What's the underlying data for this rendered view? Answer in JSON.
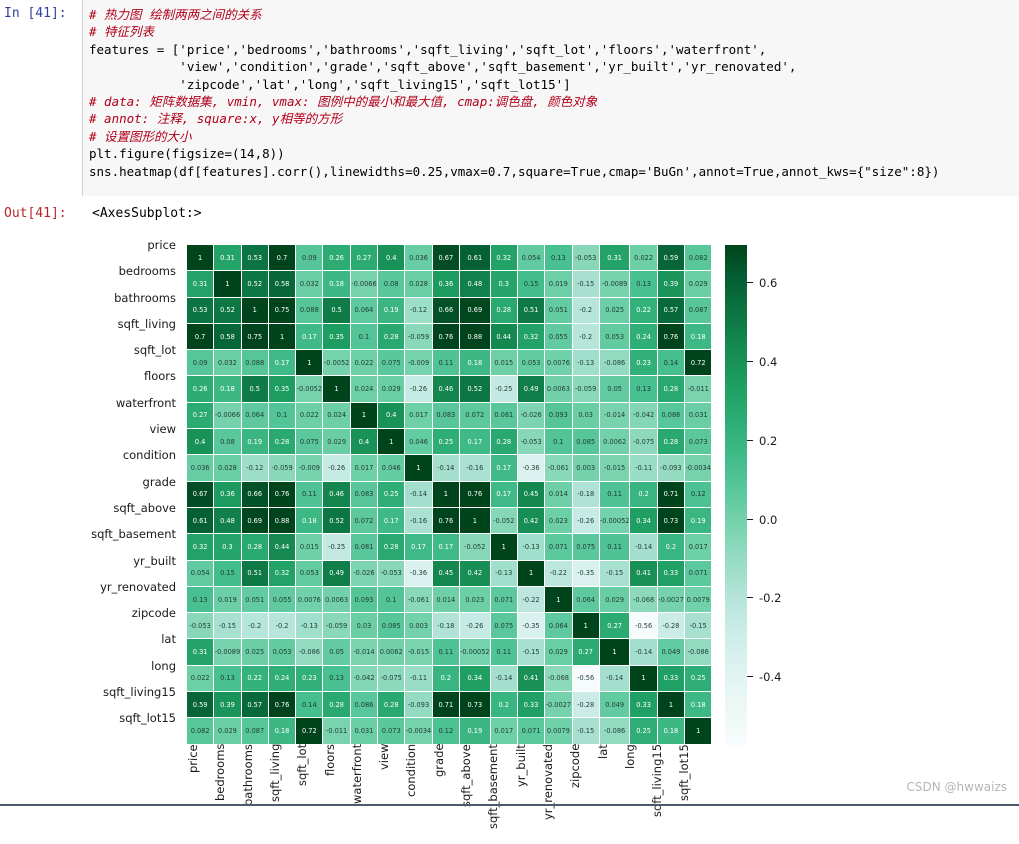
{
  "notebook": {
    "in_prompt": "In [41]:",
    "out_prompt": "Out[41]:",
    "out_text": "<AxesSubplot:>",
    "code_lines": [
      "# 热力图 绘制两两之间的关系",
      "# 特征列表",
      "features = ['price','bedrooms','bathrooms','sqft_living','sqft_lot','floors','waterfront',",
      "            'view','condition','grade','sqft_above','sqft_basement','yr_built','yr_renovated',",
      "            'zipcode','lat','long','sqft_living15','sqft_lot15']",
      "# data: 矩阵数据集, vmin, vmax: 图例中的最小和最大值, cmap:调色盘, 颜色对象",
      "# annot: 注释, square:x, y相等的方形",
      "# 设置图形的大小",
      "plt.figure(figsize=(14,8))",
      "sns.heatmap(df[features].corr(),linewidths=0.25,vmax=0.7,square=True,cmap='BuGn',annot=True,annot_kws={\"size\":8})"
    ]
  },
  "watermark": "CSDN @hwwaizs",
  "chart_data": {
    "type": "heatmap",
    "title": "",
    "xlabel": "",
    "ylabel": "",
    "cmap": "BuGn",
    "vmax": 0.7,
    "linewidths": 0.25,
    "annot": true,
    "square": true,
    "grid": false,
    "legend_position": "right",
    "colorbar_ticks": [
      "0.6",
      "0.4",
      "0.2",
      "0.0",
      "-0.2",
      "-0.4"
    ],
    "colorbar_range": [
      -0.57,
      0.7
    ],
    "categories": [
      "price",
      "bedrooms",
      "bathrooms",
      "sqft_living",
      "sqft_lot",
      "floors",
      "waterfront",
      "view",
      "condition",
      "grade",
      "sqft_above",
      "sqft_basement",
      "yr_built",
      "yr_renovated",
      "zipcode",
      "lat",
      "long",
      "sqft_living15",
      "sqft_lot15"
    ],
    "x": [
      "price",
      "bedrooms",
      "bathrooms",
      "sqft_living",
      "sqft_lot",
      "floors",
      "waterfront",
      "view",
      "condition",
      "grade",
      "sqft_above",
      "sqft_basement",
      "yr_built",
      "yr_renovated",
      "zipcode",
      "lat",
      "long",
      "sqft_living15",
      "sqft_lot15"
    ],
    "y": [
      "price",
      "bedrooms",
      "bathrooms",
      "sqft_living",
      "sqft_lot",
      "floors",
      "waterfront",
      "view",
      "condition",
      "grade",
      "sqft_above",
      "sqft_basement",
      "yr_built",
      "yr_renovated",
      "zipcode",
      "lat",
      "long",
      "sqft_living15",
      "sqft_lot15"
    ],
    "values": [
      [
        "1",
        "0.31",
        "0.53",
        "0.7",
        "0.09",
        "0.26",
        "0.27",
        "0.4",
        "0.036",
        "0.67",
        "0.61",
        "0.32",
        "0.054",
        "0.13",
        "-0.053",
        "0.31",
        "0.022",
        "0.59",
        "0.082"
      ],
      [
        "0.31",
        "1",
        "0.52",
        "0.58",
        "0.032",
        "0.18",
        "-0.0066",
        "0.08",
        "0.028",
        "0.36",
        "0.48",
        "0.3",
        "0.15",
        "0.019",
        "-0.15",
        "-0.0089",
        "0.13",
        "0.39",
        "0.029"
      ],
      [
        "0.53",
        "0.52",
        "1",
        "0.75",
        "0.088",
        "0.5",
        "0.064",
        "0.19",
        "-0.12",
        "0.66",
        "0.69",
        "0.28",
        "0.51",
        "0.051",
        "-0.2",
        "0.025",
        "0.22",
        "0.57",
        "0.087"
      ],
      [
        "0.7",
        "0.58",
        "0.75",
        "1",
        "0.17",
        "0.35",
        "0.1",
        "0.28",
        "-0.059",
        "0.76",
        "0.88",
        "0.44",
        "0.32",
        "0.055",
        "-0.2",
        "0.053",
        "0.24",
        "0.76",
        "0.18"
      ],
      [
        "0.09",
        "0.032",
        "0.088",
        "0.17",
        "1",
        "-0.0052",
        "0.022",
        "0.075",
        "-0.009",
        "0.11",
        "0.18",
        "0.015",
        "0.053",
        "0.0076",
        "-0.13",
        "-0.086",
        "0.23",
        "0.14",
        "0.72"
      ],
      [
        "0.26",
        "0.18",
        "0.5",
        "0.35",
        "-0.0052",
        "1",
        "0.024",
        "0.029",
        "-0.26",
        "0.46",
        "0.52",
        "-0.25",
        "0.49",
        "0.0063",
        "-0.059",
        "0.05",
        "0.13",
        "0.28",
        "-0.011"
      ],
      [
        "0.27",
        "-0.0066",
        "0.064",
        "0.1",
        "0.022",
        "0.024",
        "1",
        "0.4",
        "0.017",
        "0.083",
        "0.072",
        "0.081",
        "-0.026",
        "0.093",
        "0.03",
        "-0.014",
        "-0.042",
        "0.086",
        "0.031"
      ],
      [
        "0.4",
        "0.08",
        "0.19",
        "0.28",
        "0.075",
        "0.029",
        "0.4",
        "1",
        "0.046",
        "0.25",
        "0.17",
        "0.28",
        "-0.053",
        "0.1",
        "0.085",
        "0.0062",
        "-0.075",
        "0.28",
        "0.073"
      ],
      [
        "0.036",
        "0.028",
        "-0.12",
        "-0.059",
        "-0.009",
        "-0.26",
        "0.017",
        "0.046",
        "1",
        "-0.14",
        "-0.16",
        "0.17",
        "-0.36",
        "-0.061",
        "0.003",
        "-0.015",
        "-0.11",
        "-0.093",
        "-0.0034"
      ],
      [
        "0.67",
        "0.36",
        "0.66",
        "0.76",
        "0.11",
        "0.46",
        "0.083",
        "0.25",
        "-0.14",
        "1",
        "0.76",
        "0.17",
        "0.45",
        "0.014",
        "-0.18",
        "0.11",
        "0.2",
        "0.71",
        "0.12"
      ],
      [
        "0.61",
        "0.48",
        "0.69",
        "0.88",
        "0.18",
        "0.52",
        "0.072",
        "0.17",
        "-0.16",
        "0.76",
        "1",
        "-0.052",
        "0.42",
        "0.023",
        "-0.26",
        "-0.00052",
        "0.34",
        "0.73",
        "0.19"
      ],
      [
        "0.32",
        "0.3",
        "0.28",
        "0.44",
        "0.015",
        "-0.25",
        "0.081",
        "0.28",
        "0.17",
        "0.17",
        "-0.052",
        "1",
        "-0.13",
        "0.071",
        "0.075",
        "0.11",
        "-0.14",
        "0.2",
        "0.017"
      ],
      [
        "0.054",
        "0.15",
        "0.51",
        "0.32",
        "0.053",
        "0.49",
        "-0.026",
        "-0.053",
        "-0.36",
        "0.45",
        "0.42",
        "-0.13",
        "1",
        "-0.22",
        "-0.35",
        "-0.15",
        "0.41",
        "0.33",
        "0.071"
      ],
      [
        "0.13",
        "0.019",
        "0.051",
        "0.055",
        "0.0076",
        "0.0063",
        "0.093",
        "0.1",
        "-0.061",
        "0.014",
        "0.023",
        "0.071",
        "-0.22",
        "1",
        "0.064",
        "0.029",
        "-0.068",
        "-0.0027",
        "0.0079"
      ],
      [
        "-0.053",
        "-0.15",
        "-0.2",
        "-0.2",
        "-0.13",
        "-0.059",
        "0.03",
        "0.085",
        "0.003",
        "-0.18",
        "-0.26",
        "0.075",
        "-0.35",
        "0.064",
        "1",
        "0.27",
        "-0.56",
        "-0.28",
        "-0.15"
      ],
      [
        "0.31",
        "-0.0089",
        "0.025",
        "0.053",
        "-0.086",
        "0.05",
        "-0.014",
        "0.0062",
        "-0.015",
        "0.11",
        "-0.00052",
        "0.11",
        "-0.15",
        "0.029",
        "0.27",
        "1",
        "-0.14",
        "0.049",
        "-0.086"
      ],
      [
        "0.022",
        "0.13",
        "0.22",
        "0.24",
        "0.23",
        "0.13",
        "-0.042",
        "-0.075",
        "-0.11",
        "0.2",
        "0.34",
        "-0.14",
        "0.41",
        "-0.068",
        "-0.56",
        "-0.14",
        "1",
        "0.33",
        "0.25"
      ],
      [
        "0.59",
        "0.39",
        "0.57",
        "0.76",
        "0.14",
        "0.28",
        "0.086",
        "0.28",
        "-0.093",
        "0.71",
        "0.73",
        "0.2",
        "0.33",
        "-0.0027",
        "-0.28",
        "0.049",
        "0.33",
        "1",
        "0.18"
      ],
      [
        "0.082",
        "0.029",
        "0.087",
        "0.18",
        "0.72",
        "-0.011",
        "0.031",
        "0.073",
        "-0.0034",
        "0.12",
        "0.19",
        "0.017",
        "0.071",
        "0.0079",
        "-0.15",
        "-0.086",
        "0.25",
        "0.18",
        "1"
      ]
    ]
  }
}
